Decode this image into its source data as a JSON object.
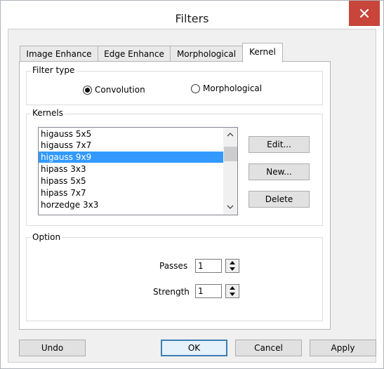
{
  "window": {
    "title": "Filters"
  },
  "tabs": [
    {
      "label": "Image Enhance",
      "active": false
    },
    {
      "label": "Edge Enhance",
      "active": false
    },
    {
      "label": "Morphological",
      "active": false
    },
    {
      "label": "Kernel",
      "active": true
    }
  ],
  "filter_type": {
    "label": "Filter type",
    "options": [
      {
        "label": "Convolution",
        "selected": true
      },
      {
        "label": "Morphological",
        "selected": false
      }
    ]
  },
  "kernels": {
    "label": "Kernels",
    "items": [
      "higauss 5x5",
      "higauss 7x7",
      "higauss 9x9",
      "hipass 3x3",
      "hipass 5x5",
      "hipass 7x7",
      "horzedge 3x3"
    ],
    "selected": "higauss 9x9",
    "edit_label": "Edit...",
    "new_label": "New...",
    "delete_label": "Delete"
  },
  "option": {
    "label": "Option",
    "passes_label": "Passes",
    "passes_value": "1",
    "strength_label": "Strength",
    "strength_value": "1"
  },
  "footer": {
    "undo_label": "Undo",
    "ok_label": "OK",
    "cancel_label": "Cancel",
    "apply_label": "Apply"
  },
  "colors": {
    "close_button": "#c7453a",
    "selection": "#3399ff"
  }
}
